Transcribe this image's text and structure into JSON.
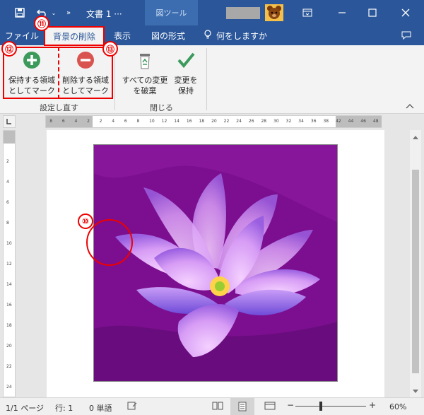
{
  "titlebar": {
    "doc_title": "文書 1 ···",
    "context_tab": "図ツール",
    "save_icon": "save-icon",
    "undo_icon": "undo-icon"
  },
  "tabs": {
    "file": "ファイル",
    "remove_bg": "背景の削除",
    "view": "表示",
    "format": "図の形式",
    "tellme": "何をしますか"
  },
  "ribbon": {
    "mark_keep_line1": "保持する領域",
    "mark_keep_line2": "としてマーク",
    "mark_remove_line1": "削除する領域",
    "mark_remove_line2": "としてマーク",
    "discard_line1": "すべての変更",
    "discard_line2": "を破棄",
    "keep_changes_line1": "変更を",
    "keep_changes_line2": "保持",
    "group_refine": "設定し直す",
    "group_close": "閉じる"
  },
  "ruler": {
    "h_ticks": [
      "8",
      "6",
      "4",
      "2",
      "2",
      "4",
      "6",
      "8",
      "10",
      "12",
      "14",
      "16",
      "18",
      "20",
      "22",
      "24",
      "26",
      "28",
      "30",
      "32",
      "34",
      "36",
      "38",
      "42",
      "44",
      "46",
      "48"
    ],
    "v_ticks": [
      "2",
      "4",
      "6",
      "8",
      "10",
      "12",
      "14",
      "16",
      "18",
      "20",
      "22",
      "24"
    ]
  },
  "annotations": {
    "n10": "⑩",
    "n11": "⑪",
    "n12": "⑫",
    "n13": "⑬"
  },
  "status": {
    "page": "1/1 ページ",
    "line": "行: 1",
    "words": "0 単語",
    "zoom": "60%"
  },
  "colors": {
    "accent": "#2b579a",
    "annotation": "#e00000",
    "photo_bg": "#7b0f8f"
  }
}
